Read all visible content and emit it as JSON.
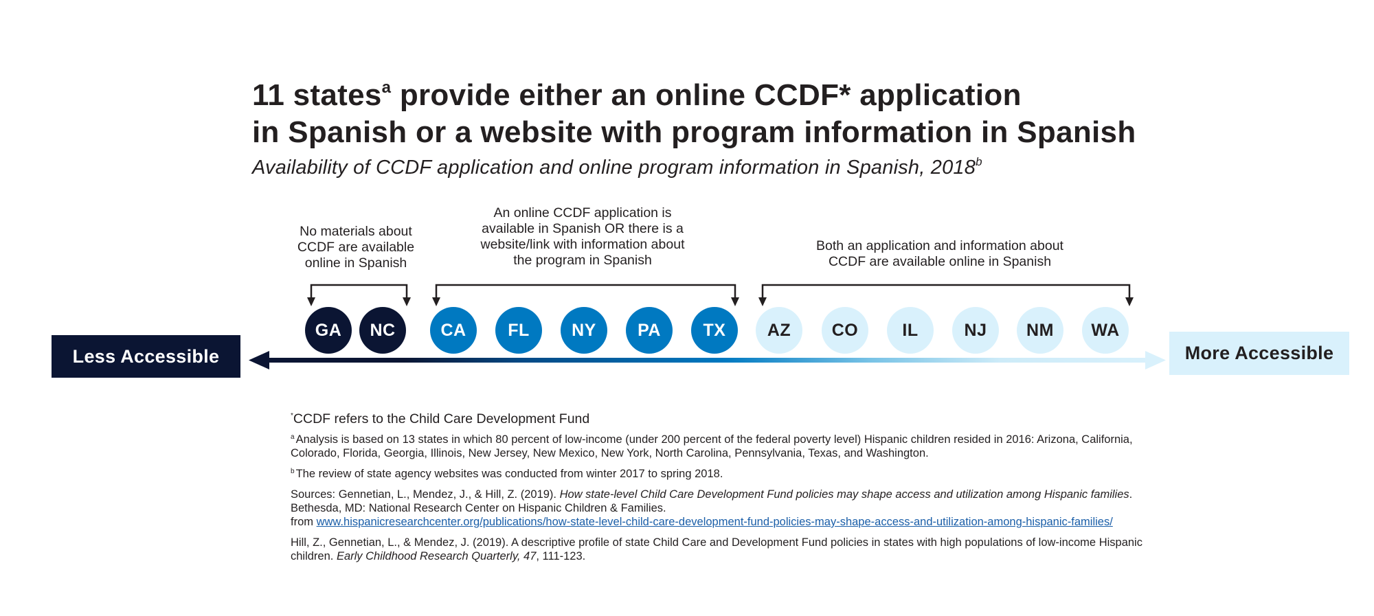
{
  "title": {
    "line1_pre": "11 states",
    "line1_sup": "a",
    "line1_post": " provide either an online CCDF* application",
    "line2": "in Spanish or a website with program information in Spanish"
  },
  "subtitle": {
    "text": "Availability of CCDF application and online program information in Spanish, 2018",
    "sup": "b"
  },
  "groups": [
    {
      "id": "none",
      "label_lines": [
        "No materials about",
        "CCDF are available",
        "online in Spanish"
      ],
      "color": "#0b1533",
      "text_color": "#ffffff",
      "states": [
        "GA",
        "NC"
      ]
    },
    {
      "id": "either",
      "label_lines": [
        "An online CCDF application is",
        "available in Spanish OR there is a",
        "website/link with information about",
        "the program in Spanish"
      ],
      "color": "#0079c1",
      "text_color": "#ffffff",
      "states": [
        "CA",
        "FL",
        "NY",
        "PA",
        "TX"
      ]
    },
    {
      "id": "both",
      "label_lines": [
        "Both an application and information about",
        "CCDF are available online in Spanish"
      ],
      "color": "#d9f1fc",
      "text_color": "#231f20",
      "states": [
        "AZ",
        "CO",
        "IL",
        "NJ",
        "NM",
        "WA"
      ]
    }
  ],
  "scale": {
    "less_label": "Less Accessible",
    "more_label": "More Accessible",
    "less_color": "#0b1533",
    "more_color": "#d9f1fc"
  },
  "notes": {
    "star": {
      "sup": "*",
      "text": "CCDF refers to the Child Care Development Fund"
    },
    "a": {
      "sup": "a",
      "text": "Analysis is based on 13 states in which 80 percent of low-income (under 200 percent of the federal poverty level) Hispanic children resided in 2016: Arizona, California, Colorado, Florida, Georgia, Illinois, New Jersey, New Mexico, New York, North Carolina, Pennsylvania, Texas, and Washington."
    },
    "b": {
      "sup": "b",
      "text": "The review of state agency websites was conducted from winter 2017 to spring 2018."
    },
    "source1": {
      "pre": "Sources: Gennetian, L., Mendez, J., & Hill, Z. (2019). ",
      "italic": "How state-level Child Care Development Fund policies may shape access and utilization among Hispanic families",
      "post": ". Bethesda, MD: National Research Center on Hispanic Children & Families.",
      "from": "from ",
      "link": "www.hispanicresearchcenter.org/publications/how-state-level-child-care-development-fund-policies-may-shape-access-and-utilization-among-hispanic-families/"
    },
    "source2": {
      "pre": "Hill, Z., Gennetian, L., & Mendez, J. (2019). A descriptive profile of state Child Care and Development Fund policies in states with high populations of low-income Hispanic children. ",
      "italic": "Early Childhood Research Quarterly, 47",
      "post": ", 111-123."
    }
  }
}
